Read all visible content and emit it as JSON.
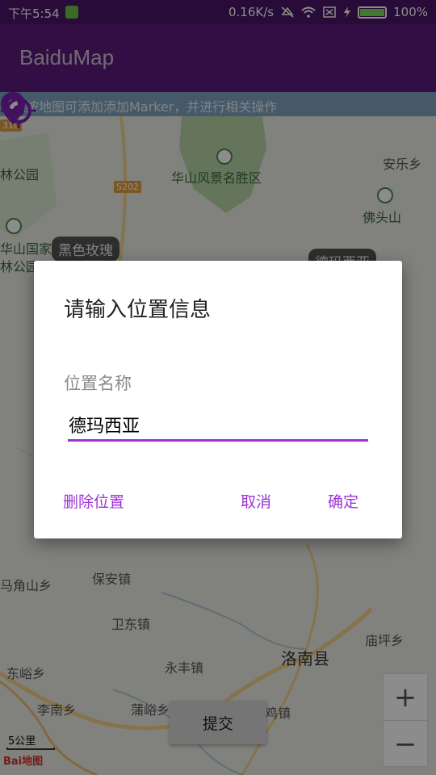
{
  "status_bar": {
    "time": "下午5:54",
    "network_speed": "0.16K/s",
    "battery": "100%"
  },
  "app_bar": {
    "title": "BaiduMap"
  },
  "map": {
    "hint": "长按地图可添加添加Marker，并进行相关操作",
    "labels": {
      "huashan_scenic": "华山风景名胜区",
      "anle": "安乐乡",
      "foutou_shan": "佛头山",
      "lin_park": "林公园",
      "huashan_national": "华山国家",
      "lin_park2": "林公园",
      "baoan": "保安镇",
      "weidong": "卫东镇",
      "yongfeng": "永丰镇",
      "luonan": "洛南县",
      "miaoping": "庙坪乡",
      "dongyu": "东峪乡",
      "puyu": "蒲峪乡",
      "majiao": "马角山乡",
      "li_nan": "李南乡",
      "dong_zhen": "鸡镇"
    },
    "road_signs": {
      "s202": "S202",
      "s310": "310"
    },
    "bubbles": {
      "black_rose": "黑色玫瑰",
      "demaxia_peek": "德玛西亚"
    },
    "scale": "5公里",
    "logo": "Bai地图",
    "zoom_in": "+",
    "zoom_out": "−",
    "submit": "提交"
  },
  "dialog": {
    "title": "请输入位置信息",
    "field_label": "位置名称",
    "field_value": "德玛西亚",
    "delete_label": "删除位置",
    "cancel_label": "取消",
    "ok_label": "确定"
  },
  "colors": {
    "status_bar": "#4a1566",
    "app_bar": "#5b1a7c",
    "accent": "#9c33d6"
  }
}
